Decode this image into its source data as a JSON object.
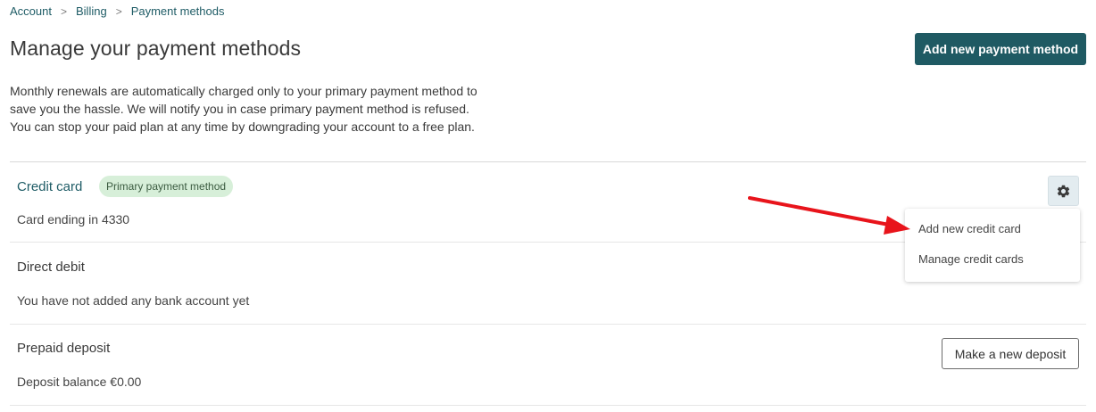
{
  "breadcrumb": {
    "items": [
      "Account",
      "Billing",
      "Payment methods"
    ],
    "separator": ">"
  },
  "header": {
    "title": "Manage your payment methods",
    "add_button_label": "Add new payment method"
  },
  "intro": {
    "text": "Monthly renewals are automatically charged only to your primary payment method to save you the hassle. We will notify you in case primary payment method is refused. You can stop your paid plan at any time by downgrading your account to a free plan."
  },
  "methods": {
    "credit_card": {
      "title": "Credit card",
      "badge": "Primary payment method",
      "desc": "Card ending in 4330",
      "settings_icon": "gear-icon"
    },
    "direct_debit": {
      "title": "Direct debit",
      "desc": "You have not added any bank account yet"
    },
    "prepaid_deposit": {
      "title": "Prepaid deposit",
      "desc": "Deposit balance €0.00",
      "button_label": "Make a new deposit"
    }
  },
  "dropdown": {
    "items": [
      "Add new credit card",
      "Manage credit cards"
    ]
  },
  "annotation": {
    "arrow_color": "#e8141b"
  },
  "colors": {
    "accent": "#1f5a63",
    "badge_bg": "#d7efd9"
  }
}
